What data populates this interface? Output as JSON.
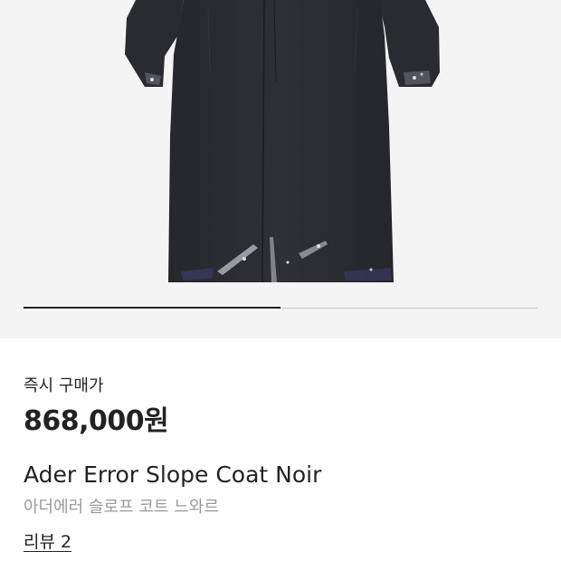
{
  "product": {
    "image_icon": "product-photo-coat",
    "carousel_progress_fraction": 0.5,
    "price_label": "즉시 구매가",
    "price": "868,000원",
    "name_en": "Ader Error Slope Coat Noir",
    "name_ko": "아더에러 슬로프 코트 느와르",
    "review_link": "리뷰 2"
  },
  "colors": {
    "image_background": "#f4f4f4",
    "coat": "#2b2c31",
    "text_primary": "#222222",
    "text_secondary": "#9a9a9a"
  }
}
